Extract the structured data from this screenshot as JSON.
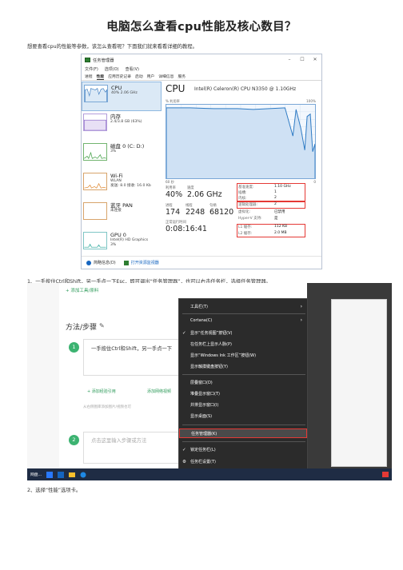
{
  "doc": {
    "title": "电脑怎么查看cpu性能及核心数目？",
    "intro": "想要查看cpu的性能等参数，该怎么查看呢？下面我们就来看看详细的教程。",
    "step1": "1、一手按住Ctrl和Shift，另一手点一下Esc，即可调出“任务管理器”，也可以右击任务栏，选择任务管理器。",
    "step2": "2、选择“性能”选项卡。"
  },
  "task_manager": {
    "window_title": "任务管理器",
    "menu": [
      "文件(F)",
      "选项(O)",
      "查看(V)"
    ],
    "tabs": [
      "进程",
      "性能",
      "应用历史记录",
      "启动",
      "用户",
      "详细信息",
      "服务"
    ],
    "active_tab": "性能",
    "sidebar": [
      {
        "name": "CPU",
        "sub1": "40%  2.06 GHz",
        "sub2": "",
        "color": "#7aa7d6"
      },
      {
        "name": "内存",
        "sub1": "2.4/3.8 GB (63%)",
        "sub2": "",
        "color": "#b39ddb"
      },
      {
        "name": "磁盘 0 (C: D:)",
        "sub1": "3%",
        "sub2": "",
        "color": "#72b46f"
      },
      {
        "name": "Wi-Fi",
        "sub1": "WLAN",
        "sub2": "发送: 8.0  接收: 16.0 Kb",
        "color": "#d8a46b"
      },
      {
        "name": "蓝牙 PAN",
        "sub1": "未连接",
        "sub2": "",
        "color": "#d8a46b"
      },
      {
        "name": "GPU 0",
        "sub1": "Intel(R) HD Graphics",
        "sub2": "3%",
        "color": "#7fc5c5"
      }
    ],
    "cpu_title": "CPU",
    "cpu_model": "Intel(R) Celeron(R) CPU N3350 @ 1.10GHz",
    "graph_label": "% 利用率",
    "graph_max": "100%",
    "graph_seconds": "60 秒",
    "graph_zero": "0",
    "stats": {
      "util_label": "利用率",
      "util_value": "40%",
      "speed_label": "速度",
      "speed_value": "2.06 GHz",
      "proc_label": "进程",
      "proc_value": "174",
      "thread_label": "线程",
      "thread_value": "2248",
      "handle_label": "句柄",
      "handle_value": "68120",
      "uptime_label": "正常运行时间",
      "uptime_value": "0:08:16:41"
    },
    "details": [
      {
        "k": "基准速度:",
        "v": "1.10 GHz"
      },
      {
        "k": "插槽:",
        "v": "1"
      },
      {
        "k": "内核:",
        "v": "2"
      },
      {
        "k": "逻辑处理器:",
        "v": "2"
      },
      {
        "k": "虚拟化:",
        "v": "已禁用"
      },
      {
        "k": "Hyper-V 支持:",
        "v": "是"
      },
      {
        "k": "L1 缓存:",
        "v": "112 KB"
      },
      {
        "k": "L2 缓存:",
        "v": "2.0 MB"
      }
    ],
    "footer": {
      "fewer": "简略信息(D)",
      "monitor": "打开资源监视器"
    }
  },
  "editor": {
    "add_tool": "+ 添加工具/原料",
    "method_title": "方法/步骤",
    "step1_text": "一手按住Ctrl和Shift，另一手点一下",
    "add_ref": "+ 添加经验引用",
    "add_video": "添加网络视频",
    "hint": "从右侧图库添加图片/视频也可",
    "step2_placeholder": "点击这里输入步骤或方法",
    "num1": "1",
    "num2": "2",
    "taskbar_text": "网盘..."
  },
  "context_menu": {
    "items": [
      {
        "label": "工具栏(T)",
        "check": "",
        "arrow": "›"
      },
      {
        "label": "Cortana(C)",
        "check": "",
        "arrow": "›"
      },
      {
        "label": "显示“任务视图”按钮(V)",
        "check": "✓",
        "arrow": ""
      },
      {
        "label": "在任务栏上显示人脉(P)",
        "check": "",
        "arrow": ""
      },
      {
        "label": "显示“Windows Ink 工作区”按钮(W)",
        "check": "",
        "arrow": ""
      },
      {
        "label": "显示触摸键盘按钮(Y)",
        "check": "",
        "arrow": ""
      },
      {
        "label": "层叠窗口(D)",
        "check": "",
        "arrow": ""
      },
      {
        "label": "堆叠显示窗口(T)",
        "check": "",
        "arrow": ""
      },
      {
        "label": "并排显示窗口(I)",
        "check": "",
        "arrow": ""
      },
      {
        "label": "显示桌面(S)",
        "check": "",
        "arrow": ""
      },
      {
        "label": "任务管理器(K)",
        "check": "",
        "arrow": ""
      },
      {
        "label": "锁定任务栏(L)",
        "check": "✓",
        "arrow": ""
      },
      {
        "label": "任务栏设置(T)",
        "check": "⚙",
        "arrow": ""
      }
    ]
  }
}
